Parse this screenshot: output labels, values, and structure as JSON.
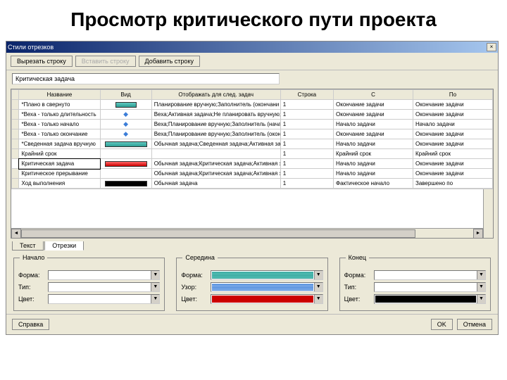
{
  "slide_title": "Просмотр критического пути проекта",
  "window_title": "Стили отрезков",
  "toolbar": {
    "cut": "Вырезать строку",
    "paste": "Вставить строку",
    "add": "Добавить строку"
  },
  "item_name": "Критическая задача",
  "columns": {
    "name": "Название",
    "look": "Вид",
    "show": "Отображать для след. задач",
    "row": "Строка",
    "from": "С",
    "to": "По"
  },
  "rows": [
    {
      "name": "*Плано в свернуто",
      "bar": "teal-short",
      "show": "Планирование вручную;Заполнитель (окончани",
      "row": "1",
      "from": "Окончание задачи",
      "to": "Окончание задачи"
    },
    {
      "name": "*Веха - только длительность",
      "bar": "diamond",
      "show": "Веха;Активная задача;Не планировать вручную;Н",
      "row": "1",
      "from": "Окончание задачи",
      "to": "Окончание задачи"
    },
    {
      "name": "*Веха - только начало",
      "bar": "diamond",
      "show": "Веха;Планирование вручную;Заполнитель (нача",
      "row": "1",
      "from": "Начало задачи",
      "to": "Начало задачи"
    },
    {
      "name": "*Веха - только окончание",
      "bar": "diamond",
      "show": "Веха;Планирование вручную;Заполнитель (окон",
      "row": "1",
      "from": "Окончание задачи",
      "to": "Окончание задачи"
    },
    {
      "name": "*Сведенная задача вручную",
      "bar": "teal",
      "show": "Обычная задача;Сведенная задача;Активная за",
      "row": "1",
      "from": "Начало задачи",
      "to": "Окончание задачи"
    },
    {
      "name": "Крайний срок",
      "bar": "",
      "show": "",
      "row": "1",
      "from": "Крайний срок",
      "to": "Крайний срок"
    },
    {
      "name": "Критическая задача",
      "sel": true,
      "bar": "red",
      "show": "Обычная задача;Критическая задача;Активная з",
      "row": "1",
      "from": "Начало задачи",
      "to": "Окончание задачи"
    },
    {
      "name": "Критическое прерывание",
      "bar": "",
      "show": "Обычная задача;Критическая задача;Активная з",
      "row": "1",
      "from": "Начало задачи",
      "to": "Окончание задачи"
    },
    {
      "name": "Ход выполнения",
      "bar": "black",
      "show": "Обычная задача",
      "row": "1",
      "from": "Фактическое начало",
      "to": "Завершено по"
    }
  ],
  "tabs": {
    "text": "Текст",
    "bars": "Отрезки"
  },
  "groups": {
    "start": {
      "title": "Начало",
      "form_label": "Форма:",
      "type_label": "Тип:",
      "color_label": "Цвет:"
    },
    "middle": {
      "title": "Середина",
      "form_label": "Форма:",
      "pattern_label": "Узор:",
      "color_label": "Цвет:"
    },
    "end": {
      "title": "Конец",
      "form_label": "Форма:",
      "type_label": "Тип:",
      "color_label": "Цвет:"
    }
  },
  "footer": {
    "help": "Справка",
    "ok": "OK",
    "cancel": "Отмена"
  }
}
